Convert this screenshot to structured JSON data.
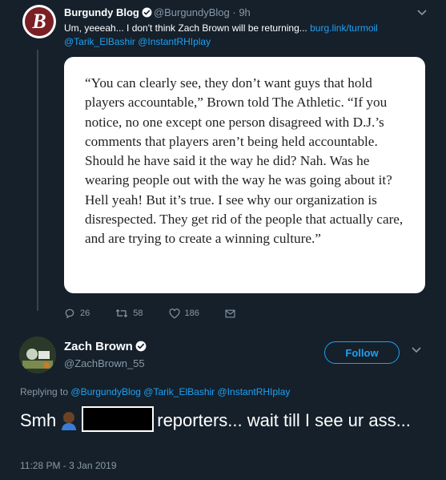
{
  "tweet1": {
    "name": "Burgundy Blog",
    "handle": "@BurgundyBlog",
    "time": "· 9h",
    "text": "Um, yeeeah... I don't think Zach Brown will be returning...",
    "link": "burg.link/turmoil",
    "mention1": "@Tarik_ElBashir",
    "mention2": "@InstantRHIplay",
    "quote": "“You can clearly see, they don’t want guys that hold players accountable,” Brown told The Athletic. “If you notice, no one except one person disagreed with D.J.’s comments that players aren’t being held accountable. Should he have said it the way he did? Nah. Was he wearing people out with the way he was going about it? Hell yeah! But it’s true. I see why our organization is disrespected. They get rid of the people that actually care, and are trying to create a winning culture.”",
    "replies": "26",
    "retweets": "58",
    "likes": "186"
  },
  "tweet2": {
    "name": "Zach Brown",
    "handle": "@ZachBrown_55",
    "follow_label": "Follow",
    "replying_prefix": "Replying to",
    "replying_to": "@BurgundyBlog @Tarik_ElBashir @InstantRHIplay",
    "text_start": "Smh",
    "text_end": "reporters... wait till I see ur ass...",
    "timestamp": "11:28 PM - 3 Jan 2019"
  },
  "colors": {
    "background": "#15202b",
    "accent": "#1da1f2",
    "muted": "#8899a6"
  }
}
